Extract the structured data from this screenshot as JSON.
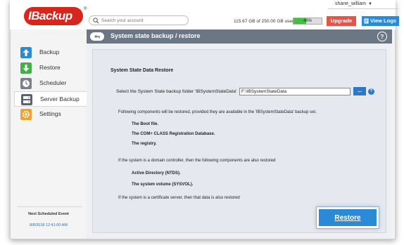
{
  "header": {
    "logo_text": "IBackup",
    "logo_mark": "®",
    "search_placeholder": "Search your account",
    "user_name": "shane_william",
    "user_caret": "▼",
    "usage_text": "115.67 GB of 250.00 GB used",
    "usage_percent_label": "46%",
    "usage_fraction": 0.46,
    "upgrade_label": "Upgrade",
    "view_logs_label": "View Logs"
  },
  "sidebar": {
    "items": [
      {
        "label": "Backup",
        "icon": "upload-arrow-icon",
        "color": "#2a8ad7"
      },
      {
        "label": "Restore",
        "icon": "download-arrow-icon",
        "color": "#3fb04a"
      },
      {
        "label": "Scheduler",
        "icon": "clock-icon",
        "color": "#7a7f8a"
      },
      {
        "label": "Server Backup",
        "icon": "server-icon",
        "color": "#5a6270",
        "active": true
      },
      {
        "label": "Settings",
        "icon": "gear-icon",
        "color": "#f0a22b"
      }
    ],
    "next_scheduled_title": "Next Scheduled Event",
    "next_scheduled_time": "8/8/2018 12:41:00 AM"
  },
  "main": {
    "title": "System state backup / restore",
    "help_label": "?",
    "section_title": "System State Data Restore",
    "select_label": "Select the System State backup folder 'IBSystemStateData'",
    "folder_value": "F:\\IBSystemStateData",
    "browse_label": "...",
    "info_label": "?",
    "components_intro": "Following components will be restored, provided they are available in the 'IBSystemStateData' backup set.",
    "components": [
      "The Boot file.",
      "The COM+ CLASS Registration Database.",
      "The registry."
    ],
    "domain_intro": "If the system is a domain controller, then the following components are also restored",
    "domain_components": [
      "Active Directory (NTDS).",
      "The system volume (SYSVOL)."
    ],
    "cert_note": "If the system is a certificate server, then that data is also restored",
    "restore_label": "Restore"
  },
  "colors": {
    "titlebar": "#6b7785",
    "accent": "#2a8ad7",
    "upgrade": "#e25547",
    "logo_red": "#d9261c",
    "usage_green": "#3fc23f"
  }
}
